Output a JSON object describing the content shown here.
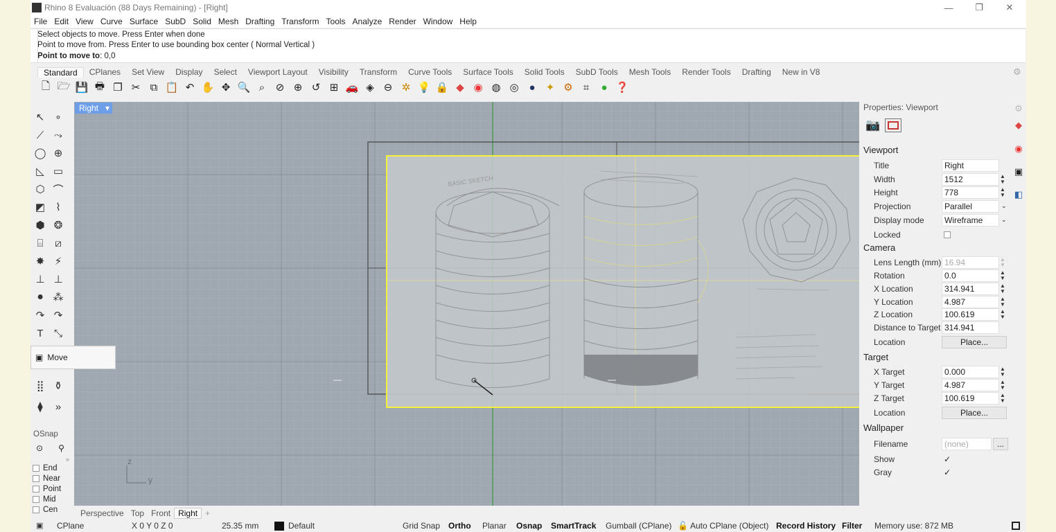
{
  "window": {
    "title": "Rhino 8 Evaluación (88 Days Remaining) - [Right]",
    "controls": [
      "—",
      "❐",
      "✕"
    ]
  },
  "menu": [
    "File",
    "Edit",
    "View",
    "Curve",
    "Surface",
    "SubD",
    "Solid",
    "Mesh",
    "Drafting",
    "Transform",
    "Tools",
    "Analyze",
    "Render",
    "Window",
    "Help"
  ],
  "command": {
    "history": [
      "Select objects to move. Press Enter when done",
      "Point to move from. Press Enter to use bounding box center ( Normal  Vertical )"
    ],
    "prompt_label": "Point to move to",
    "prompt_value": ": 0,0"
  },
  "toolbar_tabs": [
    "Standard",
    "CPlanes",
    "Set View",
    "Display",
    "Select",
    "Viewport Layout",
    "Visibility",
    "Transform",
    "Curve Tools",
    "Surface Tools",
    "Solid Tools",
    "SubD Tools",
    "Mesh Tools",
    "Render Tools",
    "Drafting",
    "New in V8"
  ],
  "toolbar_icons": [
    "new-file-icon",
    "open-file-icon",
    "save-icon",
    "print-icon",
    "import-icon",
    "cut-icon",
    "copy-icon",
    "paste-icon",
    "undo-icon",
    "pan-icon",
    "rotate-view-icon",
    "zoom-icon",
    "zoom-window-icon",
    "zoom-extents-icon",
    "zoom-selected-icon",
    "undo-view-icon",
    "viewport-layout-icon",
    "car-icon",
    "shade-icon",
    "render-icon",
    "snap-icon",
    "light-icon",
    "lock-icon",
    "layer-icon",
    "color-wheel-icon",
    "sphere-icon",
    "globe-icon",
    "material-icon",
    "sun-icon",
    "gear-icon",
    "grasshopper-icon",
    "help-icon"
  ],
  "viewport": {
    "label": "Right",
    "dropdown": "▾",
    "axis_z": "z",
    "axis_y": "y",
    "sketch_label": "BASIC SKETCH"
  },
  "tooltip": {
    "label": "Move"
  },
  "osnap": {
    "title": "OSnap",
    "items": [
      "End",
      "Near",
      "Point",
      "Mid",
      "Cen"
    ]
  },
  "view_tabs": [
    "Perspective",
    "Top",
    "Front",
    "Right",
    "+"
  ],
  "status": {
    "cplane": "CPlane",
    "coords": "X 0 Y 0 Z 0",
    "units": "25.35 mm",
    "layer": "Default",
    "grid_snap": "Grid Snap",
    "ortho": "Ortho",
    "planar": "Planar",
    "osnap": "Osnap",
    "smarttrack": "SmartTrack",
    "gumball": "Gumball (CPlane)",
    "autocplane": "Auto CPlane (Object)",
    "record_history": "Record History",
    "filter": "Filter",
    "memory": "Memory use: 872 MB"
  },
  "properties": {
    "header": "Properties: Viewport",
    "viewport_section": "Viewport",
    "title_label": "Title",
    "title_value": "Right",
    "width_label": "Width",
    "width_value": "1512",
    "height_label": "Height",
    "height_value": "778",
    "projection_label": "Projection",
    "projection_value": "Parallel",
    "display_label": "Display mode",
    "display_value": "Wireframe",
    "locked_label": "Locked",
    "camera_section": "Camera",
    "lens_label": "Lens Length (mm)",
    "lens_value": "16.94",
    "rotation_label": "Rotation",
    "rotation_value": "0.0",
    "xloc_label": "X Location",
    "xloc_value": "314.941",
    "yloc_label": "Y Location",
    "yloc_value": "4.987",
    "zloc_label": "Z Location",
    "zloc_value": "100.619",
    "dist_label": "Distance to Target",
    "dist_value": "314.941",
    "location_label": "Location",
    "place_label": "Place...",
    "target_section": "Target",
    "xt_label": "X Target",
    "xt_value": "0.000",
    "yt_label": "Y Target",
    "yt_value": "4.987",
    "zt_label": "Z Target",
    "zt_value": "100.619",
    "tlocation_label": "Location",
    "tplace_label": "Place...",
    "wallpaper_section": "Wallpaper",
    "filename_label": "Filename",
    "filename_value": "(none)",
    "browse_label": "...",
    "show_label": "Show",
    "show_check": "✓",
    "gray_label": "Gray",
    "gray_check": "✓"
  },
  "colors": {
    "viewport_bg": "#9fa7b0",
    "viewport_label": "#6d9fe8",
    "selection": "#f5f03a",
    "y_axis": "#3c9a3c",
    "x_axis": "#b04040"
  }
}
